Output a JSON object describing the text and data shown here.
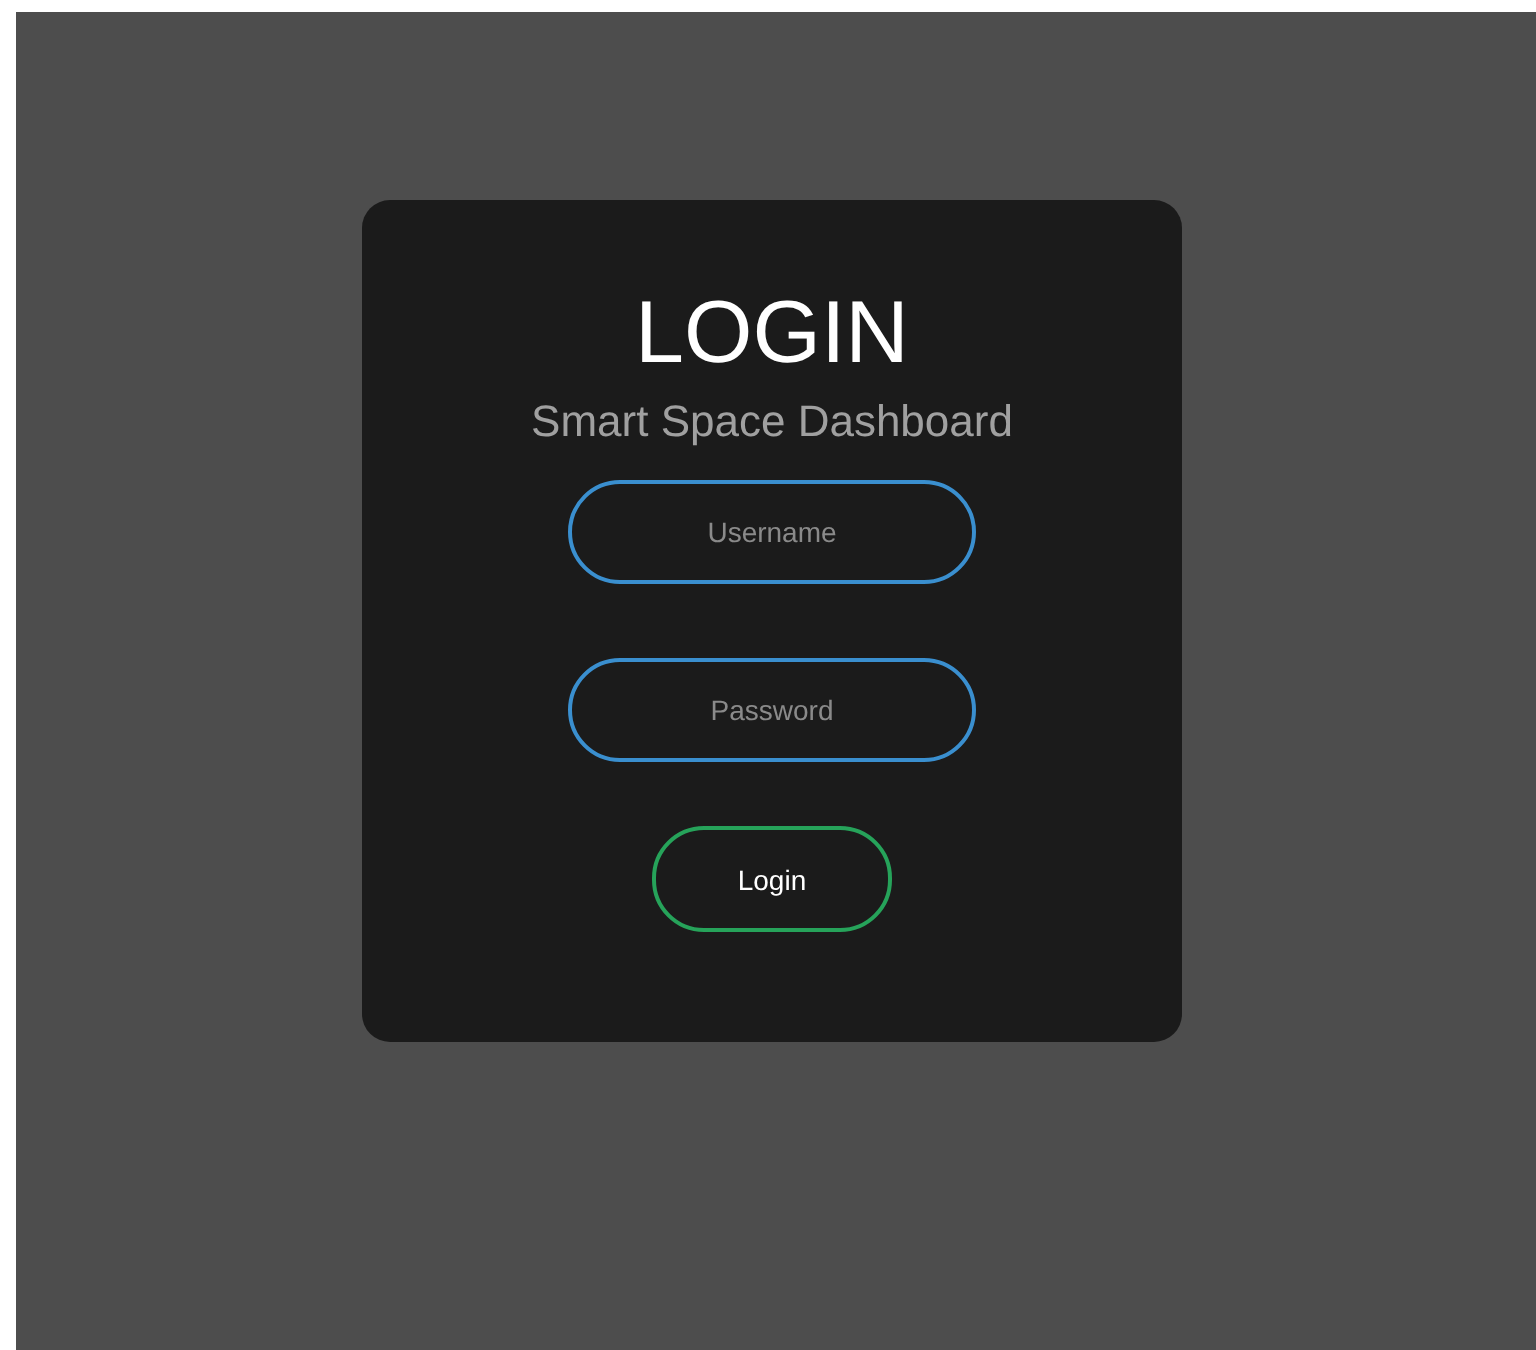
{
  "login_card": {
    "title": "LOGIN",
    "subtitle": "Smart Space Dashboard",
    "fields": [
      {
        "placeholder": "Username"
      },
      {
        "placeholder": "Password"
      }
    ],
    "button": "Login"
  }
}
